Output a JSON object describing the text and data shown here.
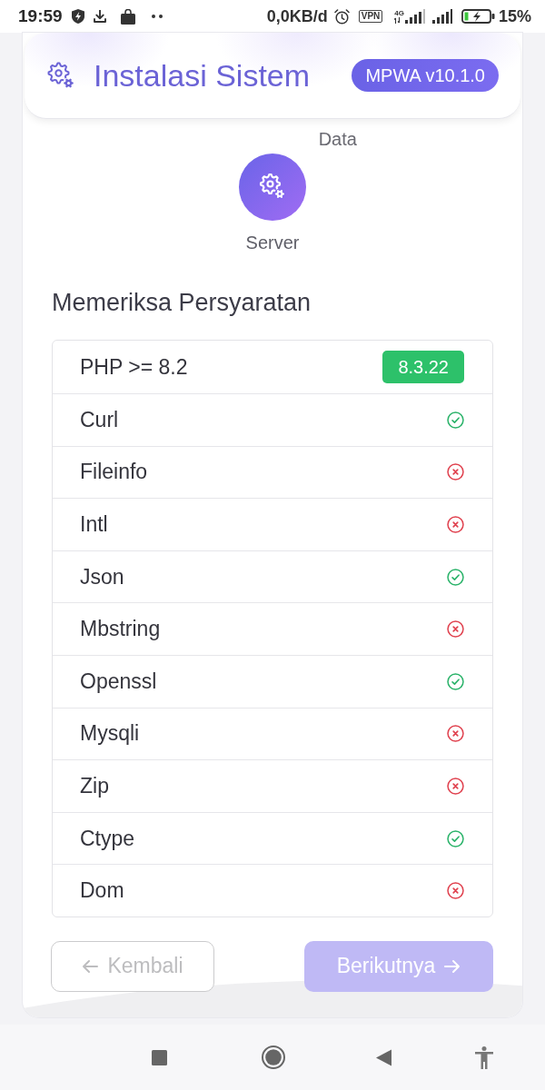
{
  "status_bar": {
    "time": "19:59",
    "data_rate": "0,0KB/d",
    "vpn_label": "VPN",
    "network_type": "4G",
    "battery_percent": "15%"
  },
  "header": {
    "title": "Instalasi Sistem",
    "version_badge": "MPWA v10.1.0"
  },
  "stepper": {
    "partial_label": "Data",
    "current_step": "Server"
  },
  "section_title": "Memeriksa Persyaratan",
  "requirements": [
    {
      "kind": "version",
      "name": "PHP >= 8.2",
      "value": "8.3.22",
      "passed": true
    },
    {
      "kind": "extension",
      "name": "Curl",
      "passed": true
    },
    {
      "kind": "extension",
      "name": "Fileinfo",
      "passed": false
    },
    {
      "kind": "extension",
      "name": "Intl",
      "passed": false
    },
    {
      "kind": "extension",
      "name": "Json",
      "passed": true
    },
    {
      "kind": "extension",
      "name": "Mbstring",
      "passed": false
    },
    {
      "kind": "extension",
      "name": "Openssl",
      "passed": true
    },
    {
      "kind": "extension",
      "name": "Mysqli",
      "passed": false
    },
    {
      "kind": "extension",
      "name": "Zip",
      "passed": false
    },
    {
      "kind": "extension",
      "name": "Ctype",
      "passed": true
    },
    {
      "kind": "extension",
      "name": "Dom",
      "passed": false
    }
  ],
  "buttons": [
    {
      "kind": "back",
      "label": "Kembali",
      "disabled": true
    },
    {
      "kind": "next",
      "label": "Berikutnya",
      "disabled": true
    }
  ]
}
